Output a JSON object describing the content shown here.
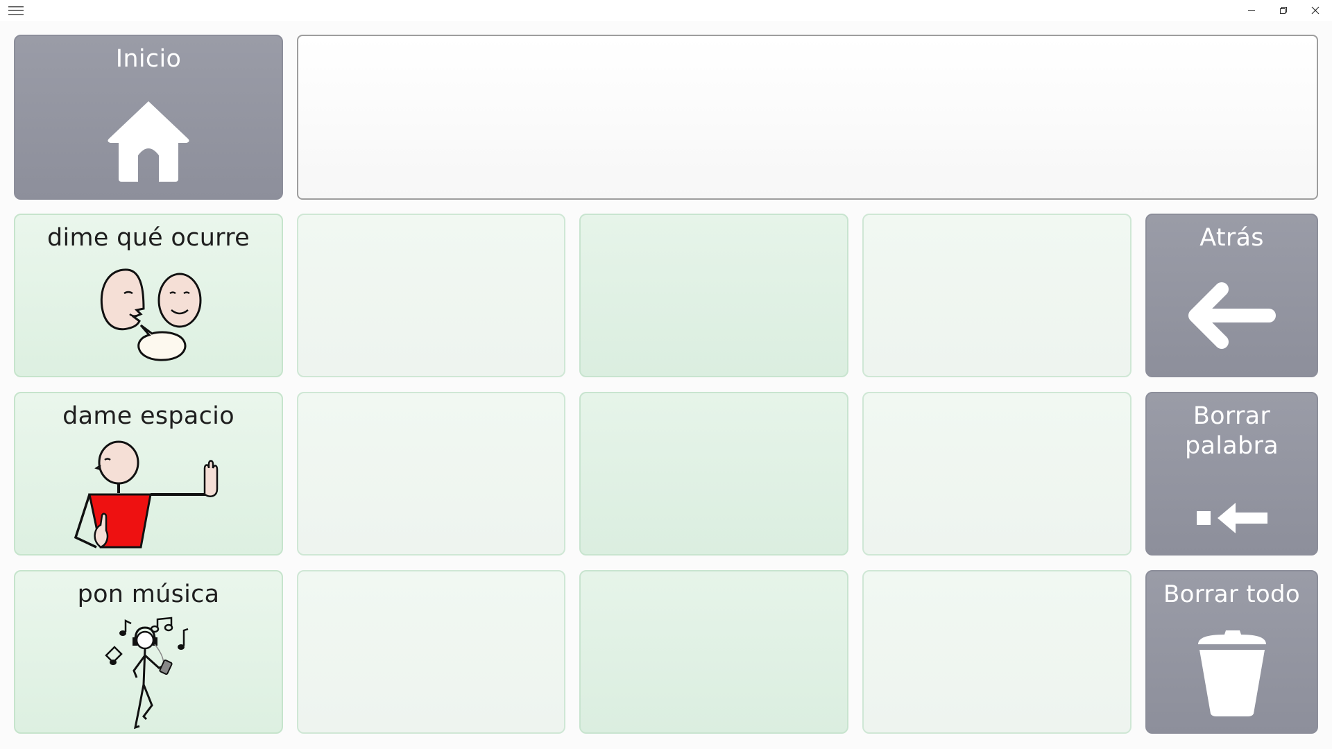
{
  "window": {
    "controls": {
      "menu": "hamburger-icon",
      "minimize": "minimize-icon",
      "restore": "restore-icon",
      "close": "close-icon"
    }
  },
  "message_bar": {
    "text": ""
  },
  "colors": {
    "nav_button": "#8f919d",
    "phrase_button": "#e2f2e5",
    "phrase_border": "#c6e4cc",
    "message_border": "#9d9d9d"
  },
  "grid": {
    "home": {
      "label": "Inicio",
      "icon": "home-icon"
    },
    "back": {
      "label": "Atrás",
      "icon": "arrow-left-icon"
    },
    "delete_word": {
      "label": "Borrar palabra",
      "icon": "backspace-icon"
    },
    "delete_all": {
      "label": "Borrar todo",
      "icon": "trash-icon"
    },
    "phrases": [
      {
        "label": "dime qué ocurre",
        "icon": "talking-faces-icon"
      },
      {
        "label": "dame espacio",
        "icon": "stop-hand-person-icon"
      },
      {
        "label": "pon música",
        "icon": "music-person-icon"
      }
    ]
  }
}
